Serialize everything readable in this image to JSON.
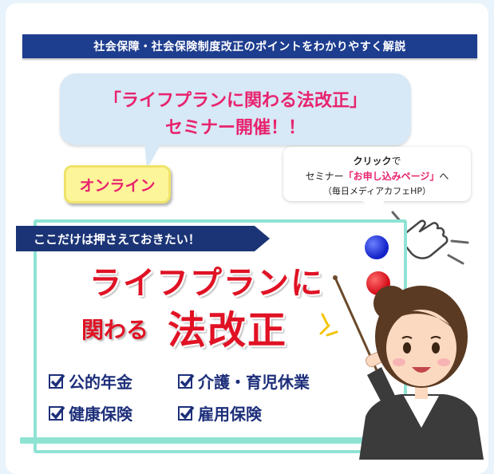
{
  "banner": {
    "text": "社会保障・社会保険制度改正のポイントをわかりやすく解説"
  },
  "bubble": {
    "line1": "「ライフプランに関わる法改正」",
    "line2": "セミナー開催！！"
  },
  "online_badge": {
    "label": "オンライン"
  },
  "callout": {
    "line1_bold": "クリック",
    "line1_rest": "で",
    "line2_prefix": "セミナー",
    "line2_link": "「お申し込みページ」",
    "line2_suffix": "へ",
    "line3": "（毎日メディアカフェHP）"
  },
  "board": {
    "ribbon": "ここだけは押さえておきたい！",
    "title_line1": "ライフプランに",
    "title_line2a": "関わる",
    "title_line2b": "法改正",
    "items": [
      "公的年金",
      "介護・育児休業",
      "健康保険",
      "雇用保険"
    ]
  },
  "colors": {
    "accent_pink": "#e8236e",
    "navy": "#1d3d8f",
    "title_red": "#e01224",
    "board_mint": "#8fe3d3"
  }
}
